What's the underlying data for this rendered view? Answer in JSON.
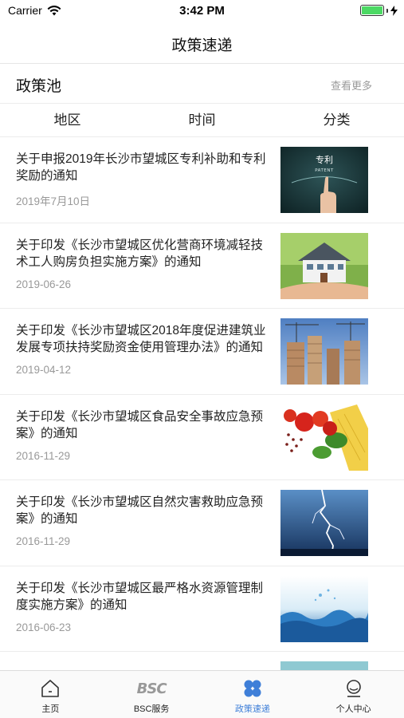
{
  "status_bar": {
    "carrier": "Carrier",
    "time": "3:42 PM",
    "battery_level": 1.0
  },
  "nav": {
    "title": "政策速递"
  },
  "section": {
    "title": "政策池",
    "more_label": "查看更多"
  },
  "filters": [
    {
      "label": "地区"
    },
    {
      "label": "时间"
    },
    {
      "label": "分类"
    }
  ],
  "news": [
    {
      "title": "关于申报2019年长沙市望城区专利补助和专利奖励的通知",
      "date": "2019年7月10日",
      "thumb": "patent-image",
      "thumb_text": "专利",
      "thumb_subtext": "PATENT"
    },
    {
      "title": "关于印发《长沙市望城区优化营商环境减轻技术工人购房负担实施方案》的通知",
      "date": "2019-06-26",
      "thumb": "house-image"
    },
    {
      "title": "关于印发《长沙市望城区2018年度促进建筑业发展专项扶持奖励资金使用管理办法》的通知",
      "date": "2019-04-12",
      "thumb": "construction-image"
    },
    {
      "title": "关于印发《长沙市望城区食品安全事故应急预案》的通知",
      "date": "2016-11-29",
      "thumb": "food-image"
    },
    {
      "title": "关于印发《长沙市望城区自然灾害救助应急预案》的通知",
      "date": "2016-11-29",
      "thumb": "lightning-image"
    },
    {
      "title": "关于印发《长沙市望城区最严格水资源管理制度实施方案》的通知",
      "date": "2016-06-23",
      "thumb": "water-image"
    }
  ],
  "tabs": [
    {
      "label": "主页",
      "icon": "home-icon",
      "active": false
    },
    {
      "label": "BSC服务",
      "icon": "bsc-logo-icon",
      "logo_text": "BSC",
      "active": false
    },
    {
      "label": "政策速递",
      "icon": "clover-icon",
      "active": true
    },
    {
      "label": "个人中心",
      "icon": "user-icon",
      "active": false
    }
  ],
  "colors": {
    "accent": "#3f7fd8",
    "battery": "#4cd964"
  }
}
